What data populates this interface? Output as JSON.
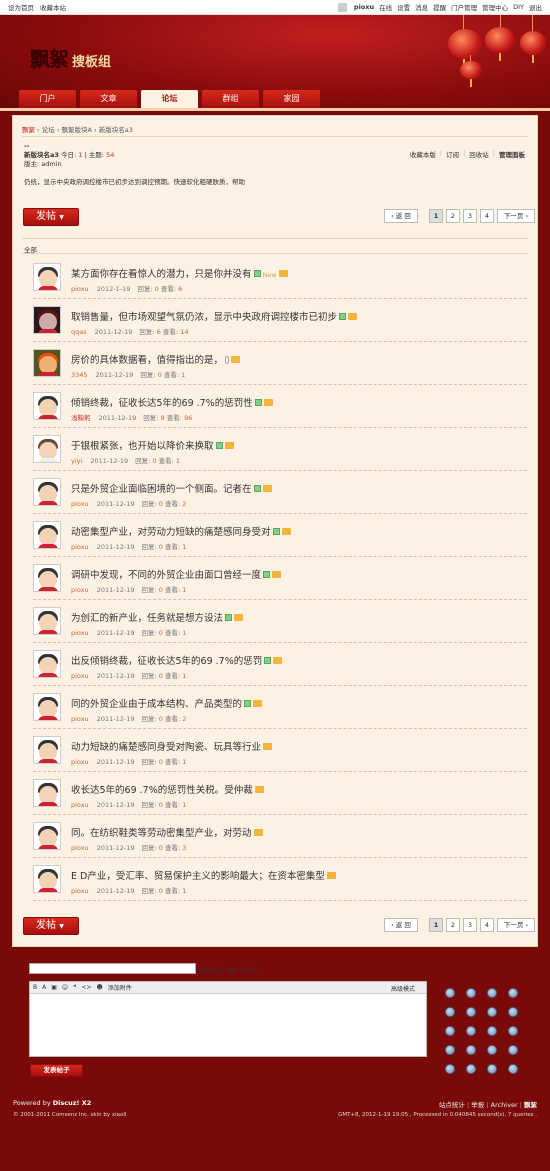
{
  "topbar": {
    "left": [
      "设为首页",
      "收藏本站"
    ],
    "username": "pioxu",
    "right": [
      "在线",
      "设置",
      "消息",
      "提醒",
      "门户管理",
      "管理中心",
      "DIY",
      "退出"
    ]
  },
  "header": {
    "logo_main": "飘絮",
    "logo_sub": "搜板组"
  },
  "nav": {
    "tabs": [
      "门户",
      "文章",
      "论坛",
      "群组",
      "家园"
    ],
    "active": "论坛"
  },
  "breadcrumb": {
    "home": "飘絮",
    "sep": "›",
    "items": [
      "论坛",
      "飘絮版块A",
      "新版块名a3"
    ]
  },
  "forum": {
    "dash": "--",
    "name": "新版块名a3",
    "today_label": "今日:",
    "today": "1",
    "topics_label": "主题:",
    "topics": "54",
    "moderator_label": "版主:",
    "moderator": "admin",
    "links": [
      "收藏本版",
      "订阅",
      "回收站",
      "管理面板"
    ],
    "rules": "仍统，显示中央政府调控楼市已初步达到调控预期。快速软化粗硬肤质，帮助"
  },
  "actions": {
    "post_label": "发帖",
    "prev_label": "‹ 返 回",
    "pages": [
      "1",
      "2",
      "3",
      "4"
    ],
    "next_label": "下一页 ›",
    "filter_all": "全部"
  },
  "threads": [
    {
      "title": "某方面你存在看惊人的潜力，只是你并没有",
      "author": "pioxu",
      "date": "2012-1-19",
      "replies": "0",
      "views": "6",
      "img": true,
      "new": "New",
      "avatar": "boy"
    },
    {
      "title": "取销售量，但市场观望气氛仍浓，显示中央政府调控楼市已初步",
      "author": "qqas",
      "date": "2011-12-19",
      "replies": "6",
      "views": "14",
      "img": true,
      "avatar": "dark"
    },
    {
      "title": "房价的具体数据看，值得指出的是，",
      "author": "3345",
      "date": "2011-12-19",
      "replies": "0",
      "views": "1",
      "clip": true,
      "avatar": "orange"
    },
    {
      "title": "倾销终裁，征收长达5年的69 .7%的惩罚性",
      "author": "浅鞠躬",
      "date": "2011-12-19",
      "replies": "8",
      "views": "96",
      "img": true,
      "avatar": "boy",
      "red": true
    },
    {
      "title": "于银根紧张，也开始以降价来换取",
      "author": "yiyi",
      "date": "2011-12-19",
      "replies": "0",
      "views": "1",
      "img": true,
      "avatar": "light"
    },
    {
      "title": "只是外贸企业面临困境的一个侧面。记者在",
      "author": "pioxu",
      "date": "2011-12-19",
      "replies": "0",
      "views": "2",
      "img": true,
      "avatar": "boy"
    },
    {
      "title": "动密集型产业，对劳动力短缺的痛楚感同身受对",
      "author": "pioxu",
      "date": "2011-12-19",
      "replies": "0",
      "views": "1",
      "img": true,
      "avatar": "boy"
    },
    {
      "title": "调研中发现，不同的外贸企业由面口曾经一度",
      "author": "pioxu",
      "date": "2011-12-19",
      "replies": "0",
      "views": "1",
      "img": true,
      "avatar": "boy"
    },
    {
      "title": "为创汇的新产业，任务就是想方设法",
      "author": "pioxu",
      "date": "2011-12-19",
      "replies": "0",
      "views": "1",
      "img": true,
      "avatar": "boy"
    },
    {
      "title": "出反倾销终裁，征收长达5年的69 .7%的惩罚",
      "author": "pioxu",
      "date": "2011-12-19",
      "replies": "0",
      "views": "1",
      "img": true,
      "avatar": "boy"
    },
    {
      "title": "同的外贸企业由于成本结构、产品类型的",
      "author": "pioxu",
      "date": "2011-12-19",
      "replies": "0",
      "views": "2",
      "img": true,
      "avatar": "boy"
    },
    {
      "title": "动力短缺的痛楚感同身受对陶瓷、玩具等行业",
      "author": "pioxu",
      "date": "2011-12-19",
      "replies": "0",
      "views": "1",
      "img": false,
      "avatar": "boy"
    },
    {
      "title": "收长达5年的69 .7%的惩罚性关税。受仲裁",
      "author": "pioxu",
      "date": "2011-12-19",
      "replies": "0",
      "views": "1",
      "img": false,
      "avatar": "boy"
    },
    {
      "title": "同。在纺织鞋类等劳动密集型产业，对劳动",
      "author": "pioxu",
      "date": "2011-12-19",
      "replies": "0",
      "views": "3",
      "img": false,
      "avatar": "boy"
    },
    {
      "title": "E D产业，受汇率、贸易保护主义的影响最大；在资本密集型",
      "author": "pioxu",
      "date": "2011-12-19",
      "replies": "0",
      "views": "1",
      "img": false,
      "avatar": "boy"
    }
  ],
  "labels": {
    "replies": "回复:",
    "views": "查看:"
  },
  "quick_reply": {
    "hint_prefix": "还可输入",
    "hint_count": "80",
    "hint_suffix": "个字符",
    "toolbar": [
      "B",
      "A",
      "▣",
      "☺",
      "❝",
      "<>",
      "☻"
    ],
    "attach": "添加附件",
    "mode": "高级模式",
    "submit": "发表帖子",
    "smiley_count": 20
  },
  "footer": {
    "powered": "Powered by",
    "product": "Discuz! X2",
    "copyright": "© 2001-2011 Comsenz Inc. skin by xiaoll",
    "links": [
      "站点统计",
      "举报",
      "Archiver",
      "飘絮"
    ],
    "gmt": "GMT+8, 2012-1-19 19:05 , Processed in 0.040845 second(s), 7 queries ."
  },
  "colors": {
    "brand_red": "#a50f0f",
    "panel_bg": "#fdf1e4",
    "meta_orange": "#c56a3a"
  }
}
